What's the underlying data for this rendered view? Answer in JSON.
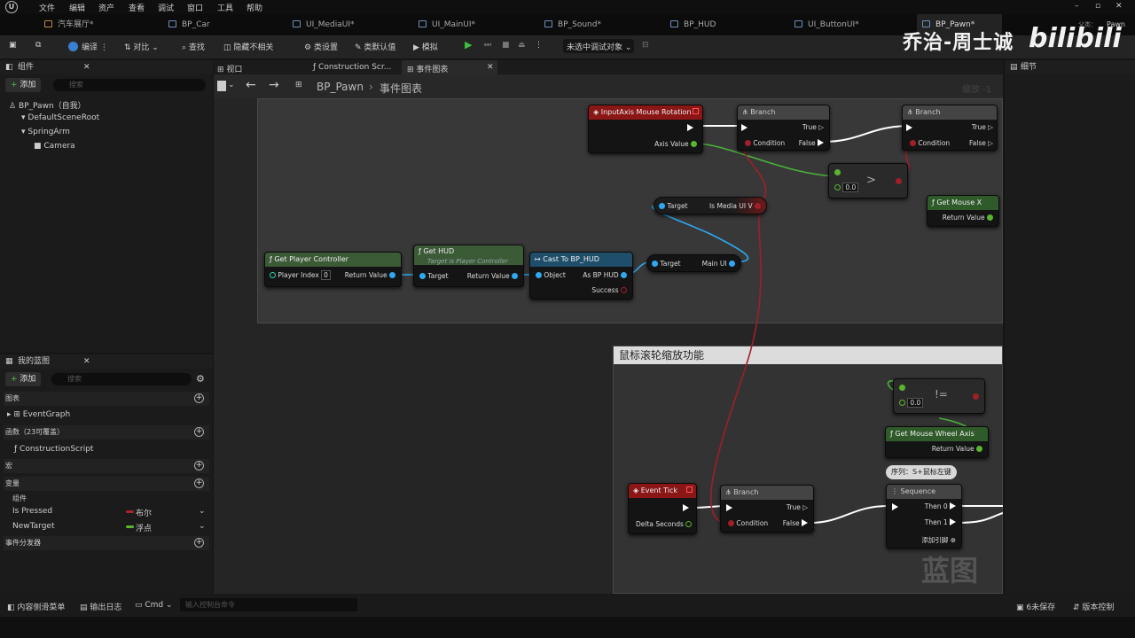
{
  "menu": {
    "items": [
      "文件",
      "编辑",
      "资产",
      "查看",
      "调试",
      "窗口",
      "工具",
      "帮助"
    ]
  },
  "tabs": [
    {
      "label": "汽车展厅*"
    },
    {
      "label": "BP_Car"
    },
    {
      "label": "UI_MediaUI*"
    },
    {
      "label": "UI_MainUI*"
    },
    {
      "label": "BP_Sound*"
    },
    {
      "label": "BP_HUD"
    },
    {
      "label": "UI_ButtonUI*"
    },
    {
      "label": "BP_Pawn*"
    }
  ],
  "tab_extra": {
    "parent_label": "父类：",
    "parent_value": "Pawn"
  },
  "toolbar": {
    "compile": "编译",
    "diff": "对比",
    "find": "查找",
    "hide": "隐藏不相关",
    "class_settings": "类设置",
    "class_defaults": "类默认值",
    "simulate": "模拟",
    "debug_target": "未选中调试对象"
  },
  "watermark": {
    "author": "乔治-周士诚",
    "site": "bilibili"
  },
  "components_panel": {
    "title": "组件",
    "add": "添加",
    "search_placeholder": "搜索",
    "tree": [
      "BP_Pawn（自我）",
      "DefaultSceneRoot",
      "SpringArm",
      "Camera"
    ]
  },
  "myblueprint_panel": {
    "title": "我的蓝图",
    "add": "添加",
    "search_placeholder": "搜索",
    "sections": {
      "graphs": "图表",
      "functions": "函数（23可覆盖）",
      "macros": "宏",
      "variables": "变量",
      "dispatchers": "事件分发器"
    },
    "event_graph": "EventGraph",
    "construction_script": "ConstructionScript",
    "components_label": "组件",
    "vars": [
      {
        "name": "Is Pressed",
        "type": "布尔",
        "color": "#8c1a1a"
      },
      {
        "name": "NewTarget",
        "type": "浮点",
        "color": "#5ab52e"
      }
    ]
  },
  "graph_tabs": {
    "viewport": "视口",
    "construction": "Construction Scr...",
    "event_graph": "事件图表"
  },
  "breadcrumb": {
    "root": "BP_Pawn",
    "current": "事件图表",
    "zoom": "缩放 -1"
  },
  "details_panel": {
    "title": "细节"
  },
  "comment2": {
    "title": "鼠标滚轮缩放功能"
  },
  "nodes": {
    "input_axis": {
      "title": "InputAxis Mouse Rotation",
      "axis_value": "Axis Value"
    },
    "branch1": {
      "title": "Branch",
      "cond": "Condition",
      "true": "True",
      "false": "False"
    },
    "branch2": {
      "title": "Branch",
      "cond": "Condition",
      "true": "True",
      "false": "False"
    },
    "greater": {
      "op": ">",
      "value": "0.0"
    },
    "get_mouse_x": {
      "title": "Get Mouse X",
      "ret": "Return Value"
    },
    "media_ui": {
      "target": "Target",
      "out": "Is Media UI V"
    },
    "get_pc": {
      "title": "Get Player Controller",
      "index_label": "Player Index",
      "index_value": "0",
      "ret": "Return Value"
    },
    "get_hud": {
      "title": "Get HUD",
      "subtitle": "Target is Player Controller",
      "target": "Target",
      "ret": "Return Value"
    },
    "cast": {
      "title": "Cast To BP_HUD",
      "object": "Object",
      "as": "As BP HUD",
      "success": "Success"
    },
    "main_ui": {
      "target": "Target",
      "out": "Main UI"
    },
    "notequal": {
      "op": "!=",
      "value": "0.0"
    },
    "get_wheel": {
      "title": "Get Mouse Wheel Axis",
      "ret": "Return Value"
    },
    "seq_comment": {
      "text": "序列：S+鼠标左键"
    },
    "event_tick": {
      "title": "Event Tick",
      "delta": "Delta Seconds"
    },
    "branch3": {
      "title": "Branch",
      "cond": "Condition",
      "true": "True",
      "false": "False"
    },
    "sequence": {
      "title": "Sequence",
      "then0": "Then 0",
      "then1": "Then 1",
      "add": "添加引脚"
    }
  },
  "graph_watermark": "蓝图",
  "bottom": {
    "drawer": "内容侧滑菜单",
    "output": "输出日志",
    "cmd": "Cmd",
    "cmd_placeholder": "输入控制台命令",
    "unsaved": "6未保存",
    "source": "版本控制"
  }
}
